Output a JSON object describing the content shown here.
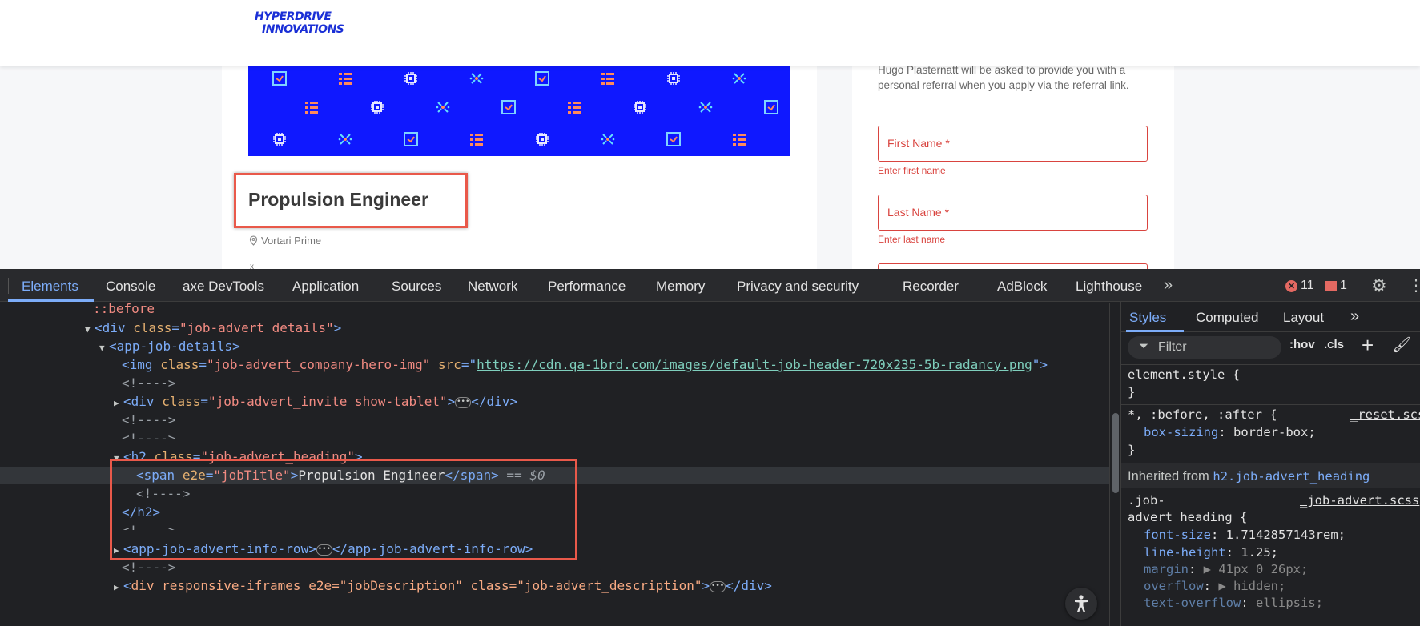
{
  "page": {
    "logo": {
      "line1": "HYPERDRIVE",
      "line2": "INNOVATIONS"
    },
    "job": {
      "title": "Propulsion Engineer",
      "location": "Vortari Prime",
      "stray": "x"
    },
    "referral_text": "Hugo Plasternatt will be asked to provide you with a personal referral when you apply via the referral link.",
    "form": {
      "first_name_label": "First Name *",
      "first_name_error": "Enter first name",
      "last_name_label": "Last Name *",
      "last_name_error": "Enter last name"
    },
    "colors": {
      "hero": "#0f18ff",
      "error": "#d9443f",
      "highlight": "#e9594a"
    }
  },
  "devtools": {
    "tabs": [
      "Elements",
      "Console",
      "axe DevTools",
      "Application",
      "Sources",
      "Network",
      "Performance",
      "Memory",
      "Privacy and security",
      "Recorder",
      "AdBlock",
      "Lighthouse"
    ],
    "more_tabs_icon": "»",
    "error_count": "11",
    "warning_count": "1",
    "dom": {
      "before": "::before",
      "div_tag": "div",
      "class_attr": "class",
      "div_class": "\"job-advert_details\"",
      "app_job_details": "app-job-details",
      "img_tag": "img",
      "img_class": "\"job-advert_company-hero-img\"",
      "src_attr": "src",
      "img_src": "https://cdn.qa-1brd.com/images/default-job-header-720x235-5b-radancy.png",
      "comment": "<!---->",
      "invite_class": "\"job-advert_invite show-tablet\"",
      "h2_tag": "h2",
      "h2_class": "\"job-advert_heading\"",
      "span_tag": "span",
      "e2e_attr": "e2e",
      "span_e2e": "\"jobTitle\"",
      "span_text": "Propulsion Engineer",
      "eq_sel": " == $0",
      "info_row_tag": "app-job-advert-info-row",
      "desc_line": "div responsive-iframes e2e=\"jobDescription\" class=\"job-advert_description\""
    },
    "styles": {
      "tabs": [
        "Styles",
        "Computed",
        "Layout"
      ],
      "filter_placeholder": "Filter",
      "hov": ":hov",
      "cls": ".cls",
      "element_style": "element.style {",
      "close_brace": "}",
      "reset_selector": "*, :before, :after {",
      "reset_source": "_reset.scss",
      "box_sizing_prop": "box-sizing",
      "box_sizing_val": "border-box;",
      "inherited_label": "Inherited from ",
      "inherited_selector": "h2.job-advert_heading",
      "rule_selector_1": ".job-",
      "rule_selector_2": "advert_heading {",
      "rule_source": "_job-advert.scss",
      "rule_props": [
        {
          "prop": "font-size",
          "val": "1.7142857143rem;"
        },
        {
          "prop": "line-height",
          "val": "1.25;"
        },
        {
          "prop": "margin",
          "val": "▶ 41px 0 26px;"
        },
        {
          "prop": "overflow",
          "val": "▶ hidden;"
        },
        {
          "prop": "text-overflow",
          "val": "ellipsis;"
        }
      ]
    }
  }
}
